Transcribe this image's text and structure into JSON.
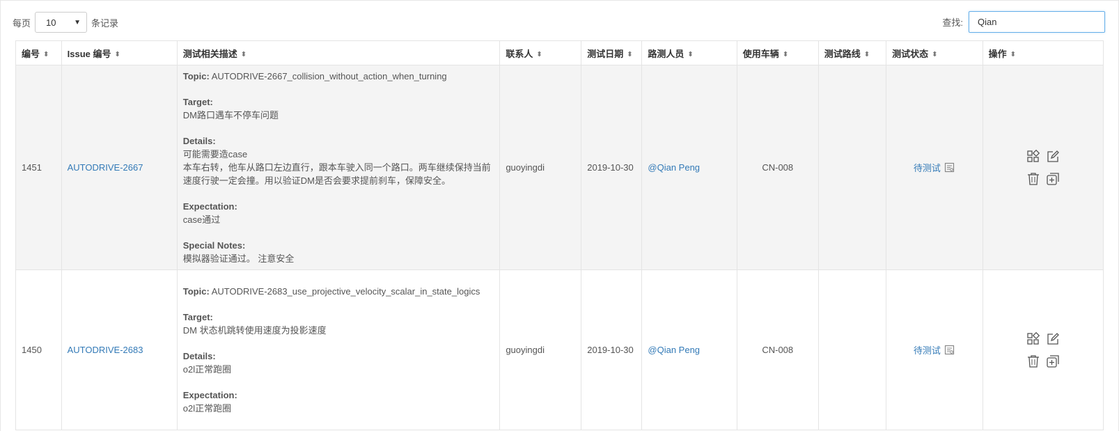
{
  "length_menu": {
    "prefix": "每页",
    "value": "10",
    "suffix": "条记录"
  },
  "search": {
    "label": "查找:",
    "value": "Qian"
  },
  "columns": [
    "编号",
    "Issue 编号",
    "测试相关描述",
    "联系人",
    "测试日期",
    "路测人员",
    "使用车辆",
    "测试路线",
    "测试状态",
    "操作"
  ],
  "rows": [
    {
      "id": "1451",
      "issue": "AUTODRIVE-2667",
      "topic_label": "Topic:",
      "topic": "AUTODRIVE-2667_collision_without_action_when_turning",
      "target_label": "Target:",
      "target": "DM路口遇车不停车问题",
      "details_label": "Details:",
      "details": [
        "可能需要造case",
        "本车右转，他车从路口左边直行，跟本车驶入同一个路口。两车继续保持当前速度行驶一定会撞。用以验证DM是否会要求提前刹车，保障安全。"
      ],
      "expectation_label": "Expectation:",
      "expectation": "case通过",
      "notes_label": "Special Notes:",
      "notes": "模拟器验证通过。 注意安全",
      "contact": "guoyingdi",
      "date": "2019-10-30",
      "tester": "@Qian Peng",
      "vehicle": "CN-008",
      "route": "",
      "status": "待测试"
    },
    {
      "id": "1450",
      "issue": "AUTODRIVE-2683",
      "topic_label": "Topic:",
      "topic": "AUTODRIVE-2683_use_projective_velocity_scalar_in_state_logics",
      "target_label": "Target:",
      "target": "DM 状态机跳转使用速度为投影速度",
      "details_label": "Details:",
      "details": [
        "o2l正常跑圈"
      ],
      "expectation_label": "Expectation:",
      "expectation": "o2l正常跑圈",
      "contact": "guoyingdi",
      "date": "2019-10-30",
      "tester": "@Qian Peng",
      "vehicle": "CN-008",
      "route": "",
      "status": "待测试"
    }
  ],
  "icons": {
    "sort": "sort-icon",
    "status_detail": "report-icon",
    "actions": [
      "apps-icon",
      "edit-icon",
      "trash-icon",
      "copy-add-icon"
    ]
  },
  "colors": {
    "link": "#337ab7",
    "row_odd": "#f4f4f4",
    "focus_border": "#66afe9"
  }
}
